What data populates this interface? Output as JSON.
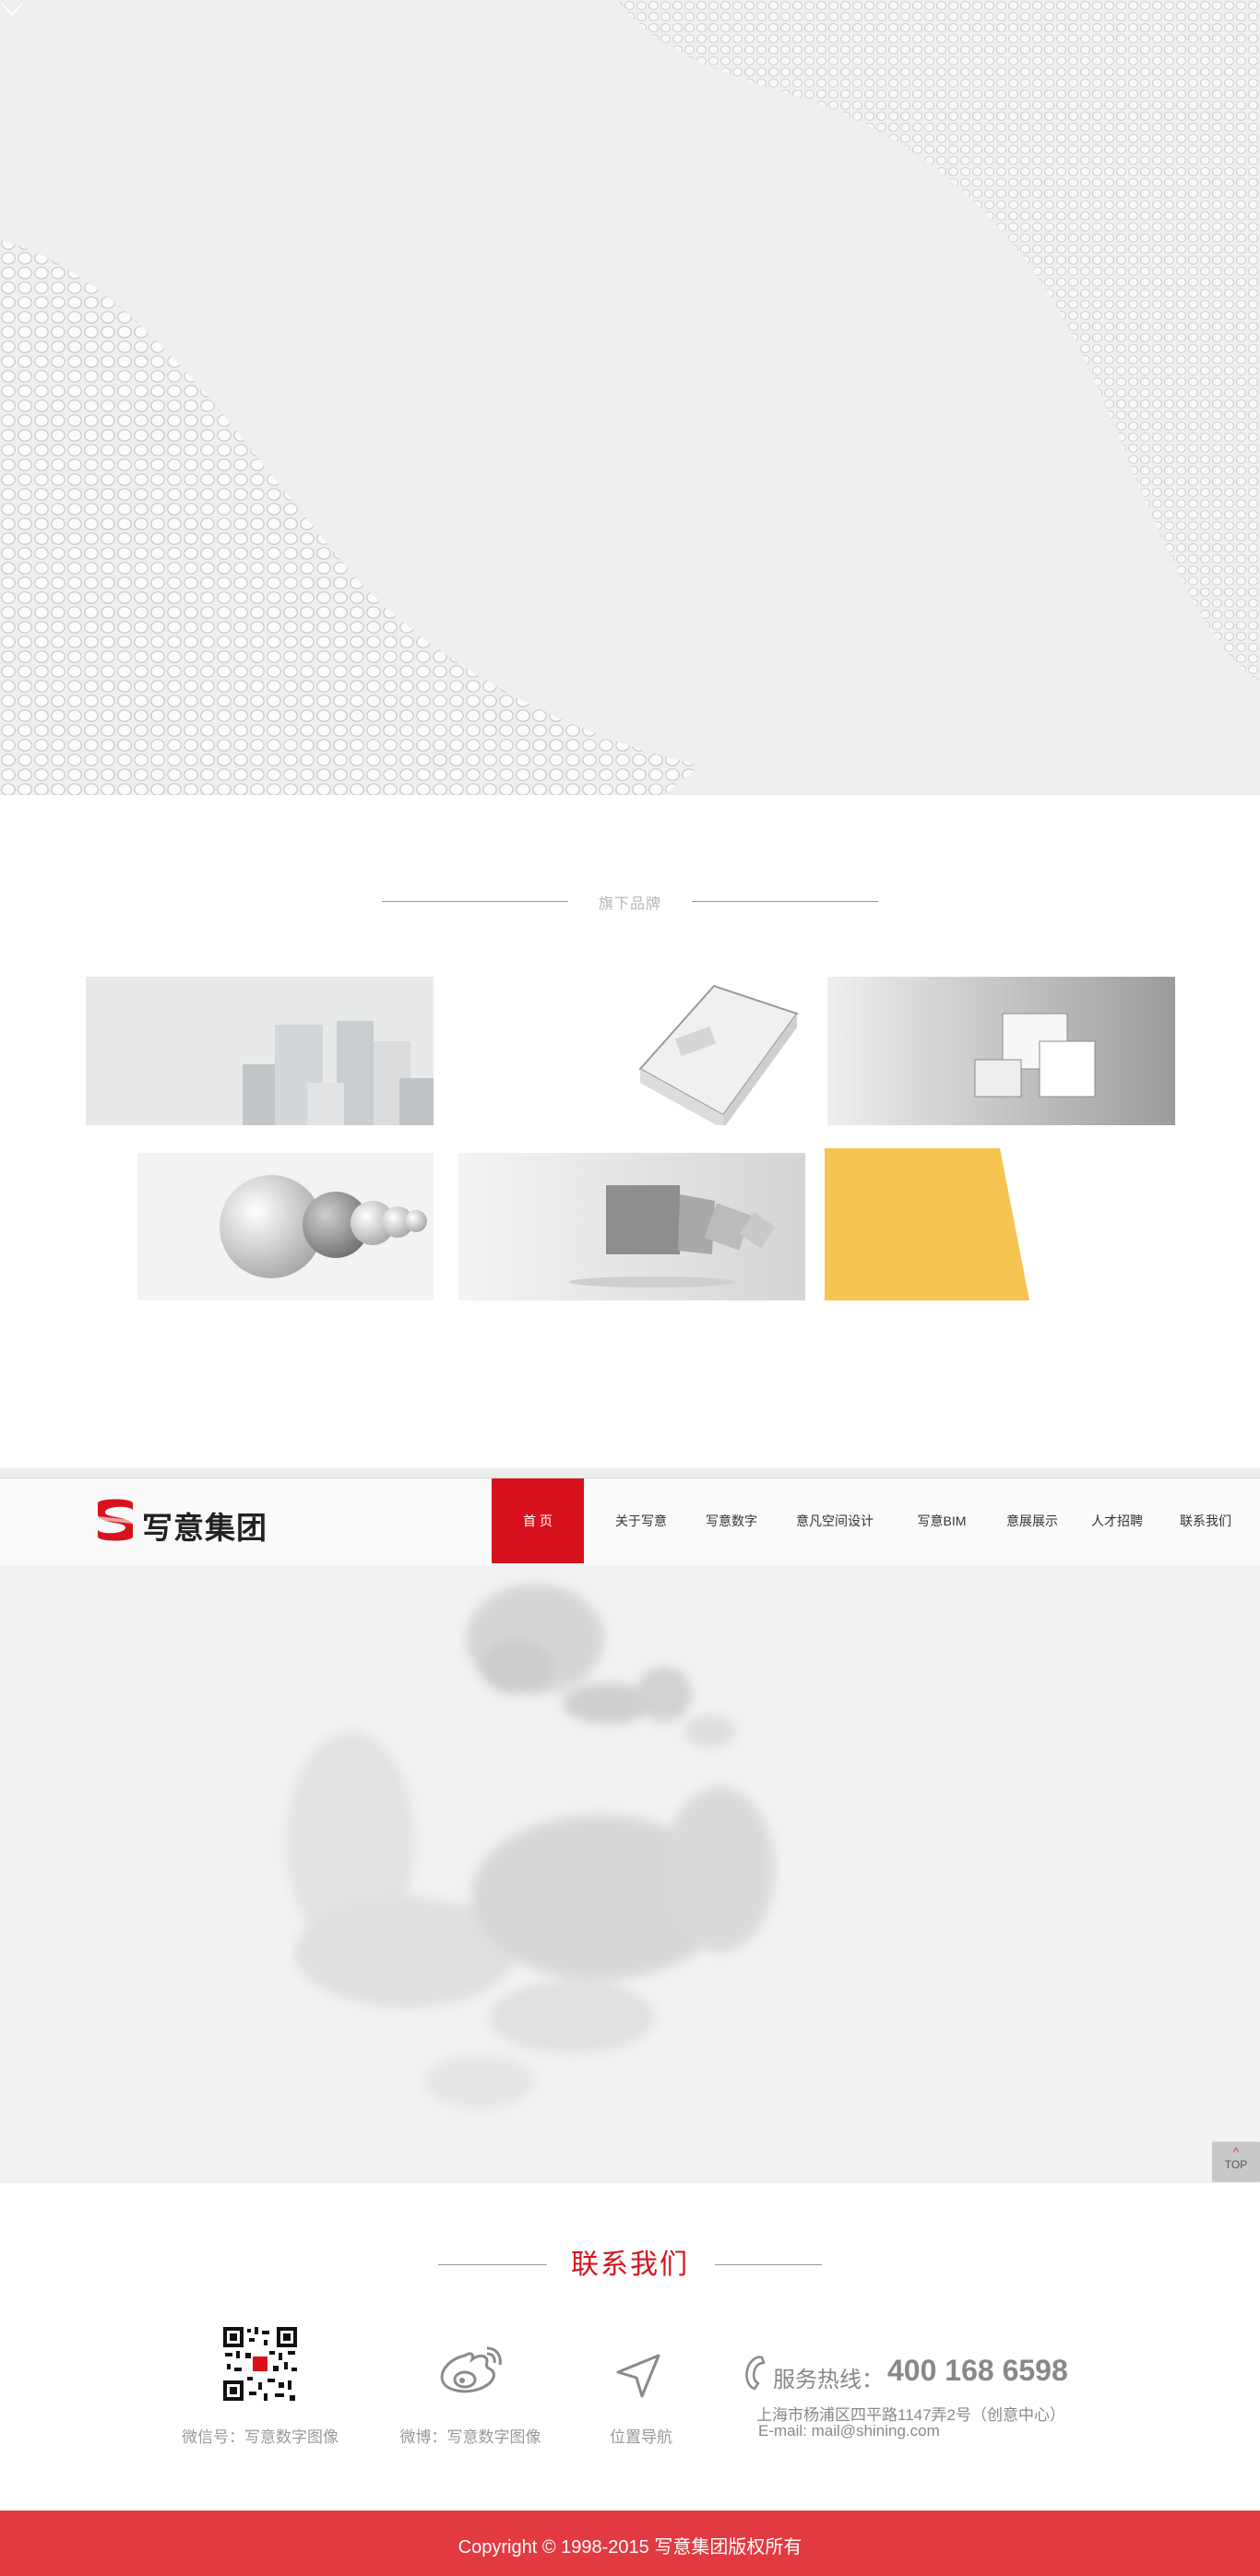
{
  "brands": {
    "title": "旗下品牌",
    "items": [
      "brand-1",
      "brand-2",
      "brand-3",
      "brand-4",
      "brand-5",
      "brand-6"
    ]
  },
  "nav": {
    "logo_text": "写意集团",
    "items": [
      "首  页",
      "关于写意",
      "写意数字",
      "意凡空间设计",
      "写意BIM",
      "意展展示",
      "人才招聘",
      "联系我们"
    ],
    "active_index": 0
  },
  "top_button": {
    "label": "TOP",
    "caret": "^"
  },
  "contact": {
    "title": "联系我们",
    "wechat_caption": "微信号：写意数字图像",
    "weibo_caption": "微博：写意数字图像",
    "location_caption": "位置导航",
    "hotline_label": "服务热线：",
    "hotline_number": "400 168 6598",
    "address": "上海市杨浦区四平路1147弄2号（创意中心）",
    "email": "E-mail: mail@shining.com"
  },
  "footer": {
    "copyright": "Copyright © 1998-2015 写意集团版权所有"
  },
  "colors": {
    "accent": "#d8121d",
    "footer_bg": "#e23a40",
    "yellow": "#f5c451"
  }
}
